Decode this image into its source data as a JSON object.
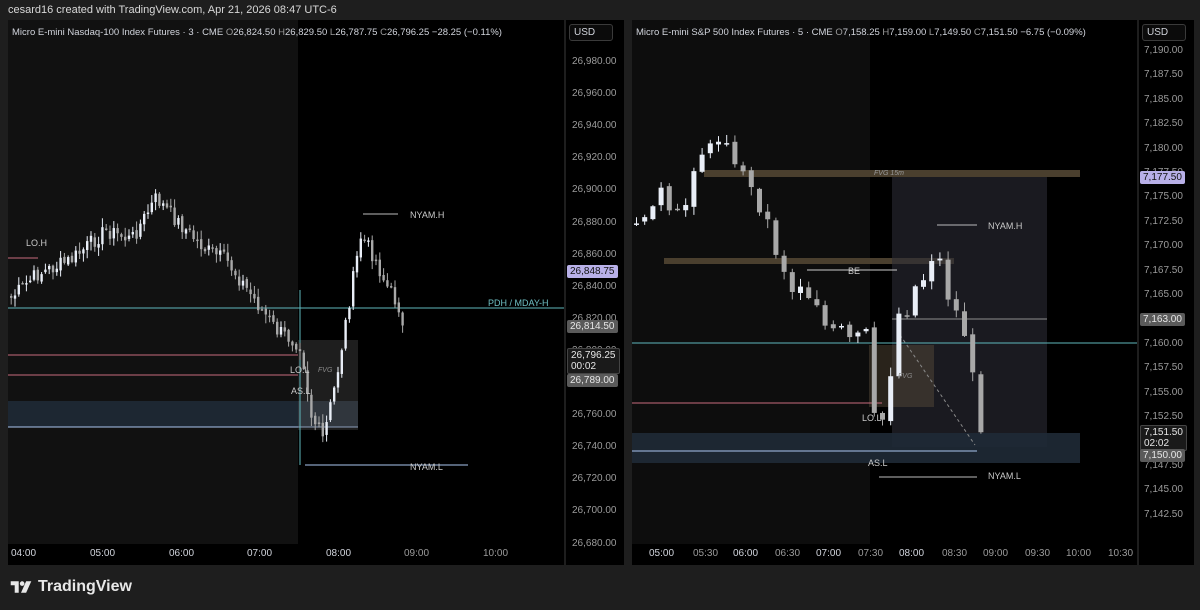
{
  "header": {
    "created_by": "cesard16 created with TradingView.com, Apr 21, 2026 08:47 UTC-6"
  },
  "brand": {
    "name": "TradingView",
    "logo_icon": "tradingview-logo-icon"
  },
  "colors": {
    "up": "#e9eef7",
    "down": "#a8a8a8",
    "accent_blue": "#aac6f0",
    "cyan": "#5fb8bd",
    "pink": "#c86a7d",
    "tag_gray": "#636363",
    "tag_purple": "#b8b0e8"
  },
  "left": {
    "legend": {
      "symbol": "Micro E-mini Nasdaq-100 Index Futures · 3 · CME",
      "o_k": "O",
      "o": "26,824.50",
      "h_k": "H",
      "h": "26,829.50",
      "l_k": "L",
      "l": "26,787.75",
      "c_k": "C",
      "c": "26,796.25",
      "chg": "−28.25 (−0.11%)"
    },
    "currency": "USD",
    "scale": {
      "min": 26680,
      "max": 26980,
      "step": 20
    },
    "price_labels": [
      "26,980.00",
      "26,960.00",
      "26,940.00",
      "26,920.00",
      "26,900.00",
      "26,880.00",
      "26,860.00",
      "26,840.00",
      "26,820.00",
      "26,800.00",
      "26,780.00",
      "26,760.00",
      "26,740.00",
      "26,720.00",
      "26,700.00",
      "26,680.00"
    ],
    "tags": {
      "t1": "26,848.75",
      "t2": "26,814.50",
      "t3a": "26,796.25",
      "t3b": "00:02",
      "t4": "26,789.00"
    },
    "time_labels": [
      "04:00",
      "05:00",
      "06:00",
      "07:00",
      "08:00",
      "09:00",
      "10:00"
    ],
    "labels": {
      "lo_h": "LO.H",
      "nyam_h": "NYAM.H",
      "pdh": "PDH / MDAY-H",
      "lo_l": "LO.L",
      "as_l": "AS.L",
      "nyam_l": "NYAM.L",
      "fvg": "FVG"
    }
  },
  "right": {
    "legend": {
      "symbol": "Micro E-mini S&P 500 Index Futures · 5 · CME",
      "o_k": "O",
      "o": "7,158.25",
      "h_k": "H",
      "h": "7,159.00",
      "l_k": "L",
      "l": "7,149.50",
      "c_k": "C",
      "c": "7,151.50",
      "chg": "−6.75 (−0.09%)"
    },
    "currency": "USD",
    "price_labels": [
      "7,190.00",
      "7,187.50",
      "7,185.00",
      "7,182.50",
      "7,180.00",
      "7,177.50",
      "7,175.00",
      "7,172.50",
      "7,170.00",
      "7,167.50",
      "7,165.00",
      "7,162.50",
      "7,160.00",
      "7,157.50",
      "7,155.00",
      "7,152.50",
      "7,150.00",
      "7,147.50",
      "7,145.00",
      "7,142.50"
    ],
    "tags": {
      "t1": "7,177.50",
      "t2": "7,163.00",
      "t3a": "7,151.50",
      "t3b": "02:02",
      "t4": "7,150.00"
    },
    "time_labels": [
      "05:00",
      "05:30",
      "06:00",
      "06:30",
      "07:00",
      "07:30",
      "08:00",
      "08:30",
      "09:00",
      "09:30",
      "10:00",
      "10:30"
    ],
    "labels": {
      "fvg15": "FVG 15m",
      "nyam_h": "NYAM.H",
      "be": "BE",
      "lo_l": "LO.L",
      "as_l": "AS.L",
      "nyam_l": "NYAM.L",
      "fvg": "FVG"
    }
  }
}
